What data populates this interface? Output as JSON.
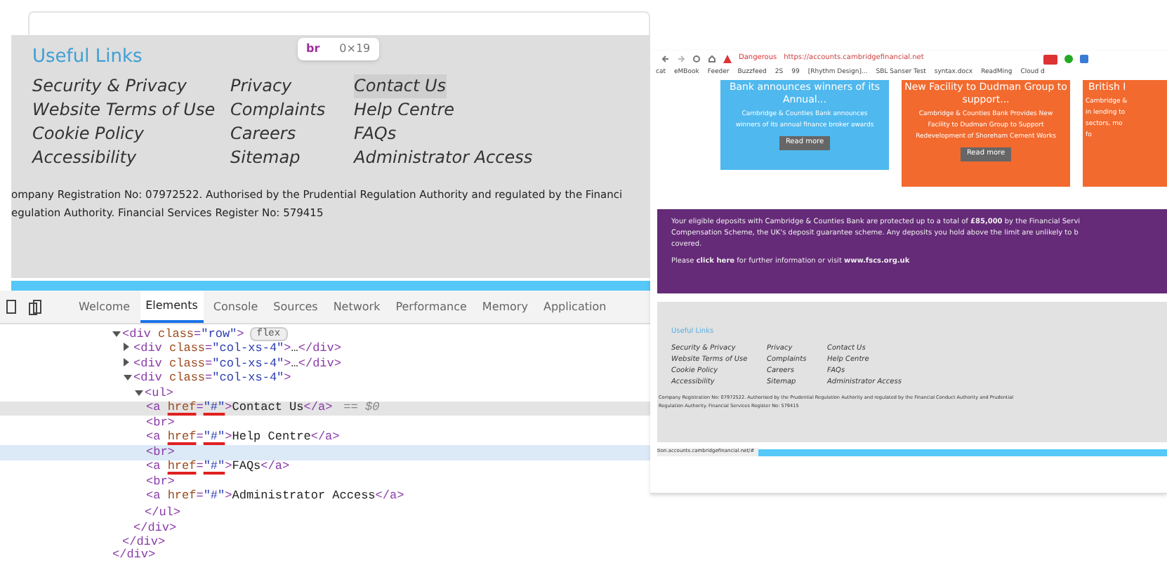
{
  "page_footer": {
    "heading": "Useful Links",
    "link_columns": [
      [
        {
          "label": "Security & Privacy",
          "highlighted": false
        },
        {
          "label": "Website Terms of Use",
          "highlighted": false
        },
        {
          "label": "Cookie Policy",
          "highlighted": false
        },
        {
          "label": "Accessibility",
          "highlighted": false
        }
      ],
      [
        {
          "label": "Privacy",
          "highlighted": false
        },
        {
          "label": "Complaints",
          "highlighted": false
        },
        {
          "label": "Careers",
          "highlighted": false
        },
        {
          "label": "Sitemap",
          "highlighted": false
        }
      ],
      [
        {
          "label": "Contact Us",
          "highlighted": true
        },
        {
          "label": "Help Centre",
          "highlighted": false
        },
        {
          "label": "FAQs",
          "highlighted": false
        },
        {
          "label": "Administrator Access",
          "highlighted": false
        }
      ]
    ],
    "legal_lines": [
      "ompany Registration No: 07972522. Authorised by the Prudential Regulation Authority and regulated by the Financi",
      "egulation Authority. Financial Services Register No: 579415"
    ]
  },
  "tooltip": {
    "tag": "br",
    "size": "0×19"
  },
  "devtools": {
    "tabs": [
      {
        "label": "Welcome",
        "selected": false
      },
      {
        "label": "Elements",
        "selected": true
      },
      {
        "label": "Console",
        "selected": false
      },
      {
        "label": "Sources",
        "selected": false
      },
      {
        "label": "Network",
        "selected": false
      },
      {
        "label": "Performance",
        "selected": false
      },
      {
        "label": "Memory",
        "selected": false
      },
      {
        "label": "Application",
        "selected": false
      }
    ],
    "tree": [
      {
        "expanded": true,
        "badge": "flex",
        "tokens": [
          {
            "kind": "tag",
            "text": "<div "
          },
          {
            "kind": "attr",
            "text": "class"
          },
          {
            "kind": "tag",
            "text": "="
          },
          {
            "kind": "val",
            "text": "\"row\""
          },
          {
            "kind": "tag",
            "text": ">"
          }
        ],
        "children": [
          {
            "expanded": false,
            "tokens": [
              {
                "kind": "tag",
                "text": "<div "
              },
              {
                "kind": "attr",
                "text": "class"
              },
              {
                "kind": "tag",
                "text": "="
              },
              {
                "kind": "val",
                "text": "\"col-xs-4\""
              },
              {
                "kind": "tag",
                "text": ">"
              },
              {
                "kind": "text",
                "text": "…"
              },
              {
                "kind": "tag",
                "text": "</div>"
              }
            ]
          },
          {
            "expanded": false,
            "tokens": [
              {
                "kind": "tag",
                "text": "<div "
              },
              {
                "kind": "attr",
                "text": "class"
              },
              {
                "kind": "tag",
                "text": "="
              },
              {
                "kind": "val",
                "text": "\"col-xs-4\""
              },
              {
                "kind": "tag",
                "text": ">"
              },
              {
                "kind": "text",
                "text": "…"
              },
              {
                "kind": "tag",
                "text": "</div>"
              }
            ]
          },
          {
            "expanded": true,
            "tokens": [
              {
                "kind": "tag",
                "text": "<div "
              },
              {
                "kind": "attr",
                "text": "class"
              },
              {
                "kind": "tag",
                "text": "="
              },
              {
                "kind": "val",
                "text": "\"col-xs-4\""
              },
              {
                "kind": "tag",
                "text": ">"
              }
            ],
            "close": "</div>",
            "children": [
              {
                "expanded": true,
                "tokens": [
                  {
                    "kind": "tag",
                    "text": "<ul>"
                  }
                ],
                "close": "</ul>",
                "children": [
                  {
                    "selected": true,
                    "hovered": false,
                    "underlined": true,
                    "suffix": "== $0",
                    "tokens": [
                      {
                        "kind": "tag",
                        "text": "<a "
                      },
                      {
                        "kind": "attr",
                        "text": "href"
                      },
                      {
                        "kind": "tag",
                        "text": "="
                      },
                      {
                        "kind": "val",
                        "text": "\"#\""
                      },
                      {
                        "kind": "tag",
                        "text": ">"
                      },
                      {
                        "kind": "text",
                        "text": "Contact Us"
                      },
                      {
                        "kind": "tag",
                        "text": "</a>"
                      }
                    ]
                  },
                  {
                    "selected": false,
                    "hovered": false,
                    "tokens": [
                      {
                        "kind": "tag",
                        "text": "<br>"
                      }
                    ]
                  },
                  {
                    "selected": false,
                    "hovered": false,
                    "underlined": true,
                    "tokens": [
                      {
                        "kind": "tag",
                        "text": "<a "
                      },
                      {
                        "kind": "attr",
                        "text": "href"
                      },
                      {
                        "kind": "tag",
                        "text": "="
                      },
                      {
                        "kind": "val",
                        "text": "\"#\""
                      },
                      {
                        "kind": "tag",
                        "text": ">"
                      },
                      {
                        "kind": "text",
                        "text": "Help Centre"
                      },
                      {
                        "kind": "tag",
                        "text": "</a>"
                      }
                    ]
                  },
                  {
                    "selected": false,
                    "hovered": true,
                    "tokens": [
                      {
                        "kind": "tag",
                        "text": "<br>"
                      }
                    ]
                  },
                  {
                    "selected": false,
                    "hovered": false,
                    "underlined": true,
                    "tokens": [
                      {
                        "kind": "tag",
                        "text": "<a "
                      },
                      {
                        "kind": "attr",
                        "text": "href"
                      },
                      {
                        "kind": "tag",
                        "text": "="
                      },
                      {
                        "kind": "val",
                        "text": "\"#\""
                      },
                      {
                        "kind": "tag",
                        "text": ">"
                      },
                      {
                        "kind": "text",
                        "text": "FAQs"
                      },
                      {
                        "kind": "tag",
                        "text": "</a>"
                      }
                    ]
                  },
                  {
                    "selected": false,
                    "hovered": false,
                    "tokens": [
                      {
                        "kind": "tag",
                        "text": "<br>"
                      }
                    ]
                  },
                  {
                    "selected": false,
                    "hovered": false,
                    "underlined": false,
                    "tokens": [
                      {
                        "kind": "tag",
                        "text": "<a "
                      },
                      {
                        "kind": "attr",
                        "text": "href"
                      },
                      {
                        "kind": "tag",
                        "text": "="
                      },
                      {
                        "kind": "val",
                        "text": "\"#\""
                      },
                      {
                        "kind": "tag",
                        "text": ">"
                      },
                      {
                        "kind": "text",
                        "text": "Administrator Access"
                      },
                      {
                        "kind": "tag",
                        "text": "</a>"
                      }
                    ]
                  }
                ]
              }
            ]
          }
        ],
        "close": "</div>"
      },
      {
        "tokens": [
          {
            "kind": "tag",
            "text": "</div>"
          }
        ]
      }
    ]
  },
  "browser_screenshot": {
    "security_label": "Dangerous",
    "url": "https://accounts.cambridgefinancial.net",
    "bookmarks": [
      "cat",
      "eMBook",
      "Feeder",
      "Buzzfeed",
      "2S",
      "99",
      "[Rhythm Design]...",
      "SBL Sanser Test",
      "syntax.docx",
      "ReadMing",
      "Cloud d"
    ],
    "cards": [
      {
        "color": "#4fb8ee",
        "title": "Bank announces winners of its Annual...",
        "body": [
          "Cambridge & Counties Bank announces",
          "winners of its annual finance broker awards"
        ],
        "button": "Read more"
      },
      {
        "color": "#f26a2e",
        "title": "New Facility to Dudman Group to support...",
        "body": [
          "Cambridge & Counties Bank Provides New",
          "Facility to Dudman Group to Support",
          "Redevelopment of Shoreham Cement Works"
        ],
        "button": "Read more"
      },
      {
        "color": "#f26a2e",
        "title": "British I",
        "body": [
          "Cambridge &",
          "in lending to",
          "sectors, mo",
          "fo"
        ]
      }
    ],
    "notice": {
      "lines": [
        "Your eligible deposits with Cambridge & Counties Bank are protected up to a total of **£85,000** by the Financial Servi",
        "Compensation Scheme, the UK's deposit guarantee scheme. Any deposits you hold above the limit are unlikely to b",
        "covered."
      ],
      "link_line": "Please **click here** for further information or visit **www.fscs.org.uk**"
    },
    "footer": {
      "heading": "Useful Links",
      "link_columns": [
        [
          "Security & Privacy",
          "Website Terms of Use",
          "Cookie Policy",
          "Accessibility"
        ],
        [
          "Privacy",
          "Complaints",
          "Careers",
          "Sitemap"
        ],
        [
          "Contact Us",
          "Help Centre",
          "FAQs",
          "Administrator Access"
        ]
      ],
      "legal_lines": [
        "Company Registration No: 07972522. Authorised by the Prudential Regulation Authority and regulated by the Financial Conduct Authority and Prudential",
        "Regulation Authority. Financial Services Register No: 579415"
      ]
    },
    "status_url": "tion.accounts.cambridgefinancial.net/#"
  }
}
